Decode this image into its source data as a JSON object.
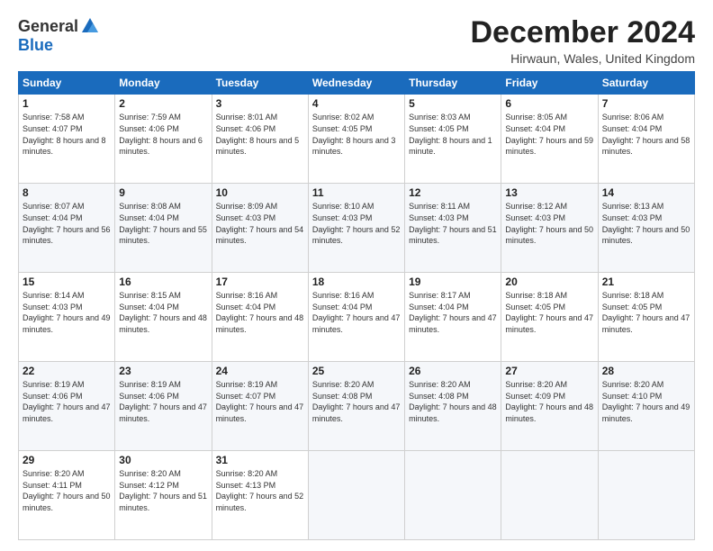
{
  "logo": {
    "general": "General",
    "blue": "Blue"
  },
  "title": "December 2024",
  "subtitle": "Hirwaun, Wales, United Kingdom",
  "days_of_week": [
    "Sunday",
    "Monday",
    "Tuesday",
    "Wednesday",
    "Thursday",
    "Friday",
    "Saturday"
  ],
  "weeks": [
    [
      {
        "day": "1",
        "sunrise": "Sunrise: 7:58 AM",
        "sunset": "Sunset: 4:07 PM",
        "daylight": "Daylight: 8 hours and 8 minutes."
      },
      {
        "day": "2",
        "sunrise": "Sunrise: 7:59 AM",
        "sunset": "Sunset: 4:06 PM",
        "daylight": "Daylight: 8 hours and 6 minutes."
      },
      {
        "day": "3",
        "sunrise": "Sunrise: 8:01 AM",
        "sunset": "Sunset: 4:06 PM",
        "daylight": "Daylight: 8 hours and 5 minutes."
      },
      {
        "day": "4",
        "sunrise": "Sunrise: 8:02 AM",
        "sunset": "Sunset: 4:05 PM",
        "daylight": "Daylight: 8 hours and 3 minutes."
      },
      {
        "day": "5",
        "sunrise": "Sunrise: 8:03 AM",
        "sunset": "Sunset: 4:05 PM",
        "daylight": "Daylight: 8 hours and 1 minute."
      },
      {
        "day": "6",
        "sunrise": "Sunrise: 8:05 AM",
        "sunset": "Sunset: 4:04 PM",
        "daylight": "Daylight: 7 hours and 59 minutes."
      },
      {
        "day": "7",
        "sunrise": "Sunrise: 8:06 AM",
        "sunset": "Sunset: 4:04 PM",
        "daylight": "Daylight: 7 hours and 58 minutes."
      }
    ],
    [
      {
        "day": "8",
        "sunrise": "Sunrise: 8:07 AM",
        "sunset": "Sunset: 4:04 PM",
        "daylight": "Daylight: 7 hours and 56 minutes."
      },
      {
        "day": "9",
        "sunrise": "Sunrise: 8:08 AM",
        "sunset": "Sunset: 4:04 PM",
        "daylight": "Daylight: 7 hours and 55 minutes."
      },
      {
        "day": "10",
        "sunrise": "Sunrise: 8:09 AM",
        "sunset": "Sunset: 4:03 PM",
        "daylight": "Daylight: 7 hours and 54 minutes."
      },
      {
        "day": "11",
        "sunrise": "Sunrise: 8:10 AM",
        "sunset": "Sunset: 4:03 PM",
        "daylight": "Daylight: 7 hours and 52 minutes."
      },
      {
        "day": "12",
        "sunrise": "Sunrise: 8:11 AM",
        "sunset": "Sunset: 4:03 PM",
        "daylight": "Daylight: 7 hours and 51 minutes."
      },
      {
        "day": "13",
        "sunrise": "Sunrise: 8:12 AM",
        "sunset": "Sunset: 4:03 PM",
        "daylight": "Daylight: 7 hours and 50 minutes."
      },
      {
        "day": "14",
        "sunrise": "Sunrise: 8:13 AM",
        "sunset": "Sunset: 4:03 PM",
        "daylight": "Daylight: 7 hours and 50 minutes."
      }
    ],
    [
      {
        "day": "15",
        "sunrise": "Sunrise: 8:14 AM",
        "sunset": "Sunset: 4:03 PM",
        "daylight": "Daylight: 7 hours and 49 minutes."
      },
      {
        "day": "16",
        "sunrise": "Sunrise: 8:15 AM",
        "sunset": "Sunset: 4:04 PM",
        "daylight": "Daylight: 7 hours and 48 minutes."
      },
      {
        "day": "17",
        "sunrise": "Sunrise: 8:16 AM",
        "sunset": "Sunset: 4:04 PM",
        "daylight": "Daylight: 7 hours and 48 minutes."
      },
      {
        "day": "18",
        "sunrise": "Sunrise: 8:16 AM",
        "sunset": "Sunset: 4:04 PM",
        "daylight": "Daylight: 7 hours and 47 minutes."
      },
      {
        "day": "19",
        "sunrise": "Sunrise: 8:17 AM",
        "sunset": "Sunset: 4:04 PM",
        "daylight": "Daylight: 7 hours and 47 minutes."
      },
      {
        "day": "20",
        "sunrise": "Sunrise: 8:18 AM",
        "sunset": "Sunset: 4:05 PM",
        "daylight": "Daylight: 7 hours and 47 minutes."
      },
      {
        "day": "21",
        "sunrise": "Sunrise: 8:18 AM",
        "sunset": "Sunset: 4:05 PM",
        "daylight": "Daylight: 7 hours and 47 minutes."
      }
    ],
    [
      {
        "day": "22",
        "sunrise": "Sunrise: 8:19 AM",
        "sunset": "Sunset: 4:06 PM",
        "daylight": "Daylight: 7 hours and 47 minutes."
      },
      {
        "day": "23",
        "sunrise": "Sunrise: 8:19 AM",
        "sunset": "Sunset: 4:06 PM",
        "daylight": "Daylight: 7 hours and 47 minutes."
      },
      {
        "day": "24",
        "sunrise": "Sunrise: 8:19 AM",
        "sunset": "Sunset: 4:07 PM",
        "daylight": "Daylight: 7 hours and 47 minutes."
      },
      {
        "day": "25",
        "sunrise": "Sunrise: 8:20 AM",
        "sunset": "Sunset: 4:08 PM",
        "daylight": "Daylight: 7 hours and 47 minutes."
      },
      {
        "day": "26",
        "sunrise": "Sunrise: 8:20 AM",
        "sunset": "Sunset: 4:08 PM",
        "daylight": "Daylight: 7 hours and 48 minutes."
      },
      {
        "day": "27",
        "sunrise": "Sunrise: 8:20 AM",
        "sunset": "Sunset: 4:09 PM",
        "daylight": "Daylight: 7 hours and 48 minutes."
      },
      {
        "day": "28",
        "sunrise": "Sunrise: 8:20 AM",
        "sunset": "Sunset: 4:10 PM",
        "daylight": "Daylight: 7 hours and 49 minutes."
      }
    ],
    [
      {
        "day": "29",
        "sunrise": "Sunrise: 8:20 AM",
        "sunset": "Sunset: 4:11 PM",
        "daylight": "Daylight: 7 hours and 50 minutes."
      },
      {
        "day": "30",
        "sunrise": "Sunrise: 8:20 AM",
        "sunset": "Sunset: 4:12 PM",
        "daylight": "Daylight: 7 hours and 51 minutes."
      },
      {
        "day": "31",
        "sunrise": "Sunrise: 8:20 AM",
        "sunset": "Sunset: 4:13 PM",
        "daylight": "Daylight: 7 hours and 52 minutes."
      },
      null,
      null,
      null,
      null
    ]
  ]
}
